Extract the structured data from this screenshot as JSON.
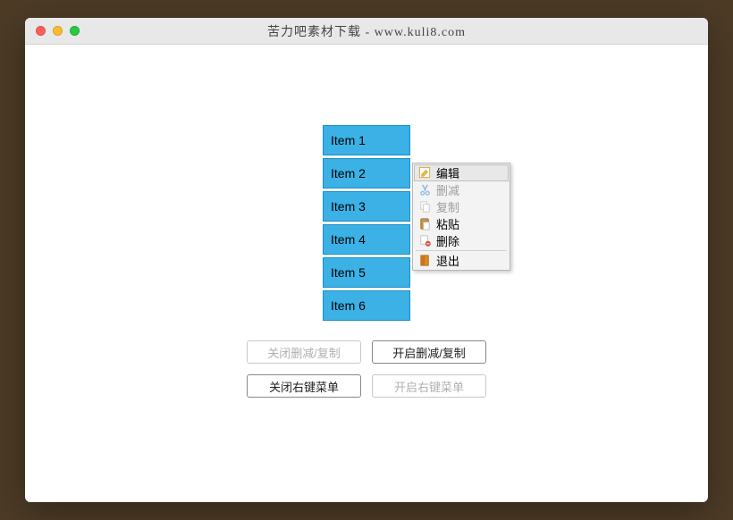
{
  "window": {
    "title": "苦力吧素材下载 - www.kuli8.com"
  },
  "list": {
    "items": [
      "Item 1",
      "Item 2",
      "Item 3",
      "Item 4",
      "Item 5",
      "Item 6"
    ]
  },
  "contextMenu": {
    "edit": "编辑",
    "cut": "删减",
    "copy": "复制",
    "paste": "粘贴",
    "delete": "删除",
    "quit": "退出"
  },
  "buttons": {
    "closeCutCopy": "关闭删减/复制",
    "openCutCopy": "开启删减/复制",
    "closeContextMenu": "关闭右键菜单",
    "openContextMenu": "开启右键菜单"
  }
}
